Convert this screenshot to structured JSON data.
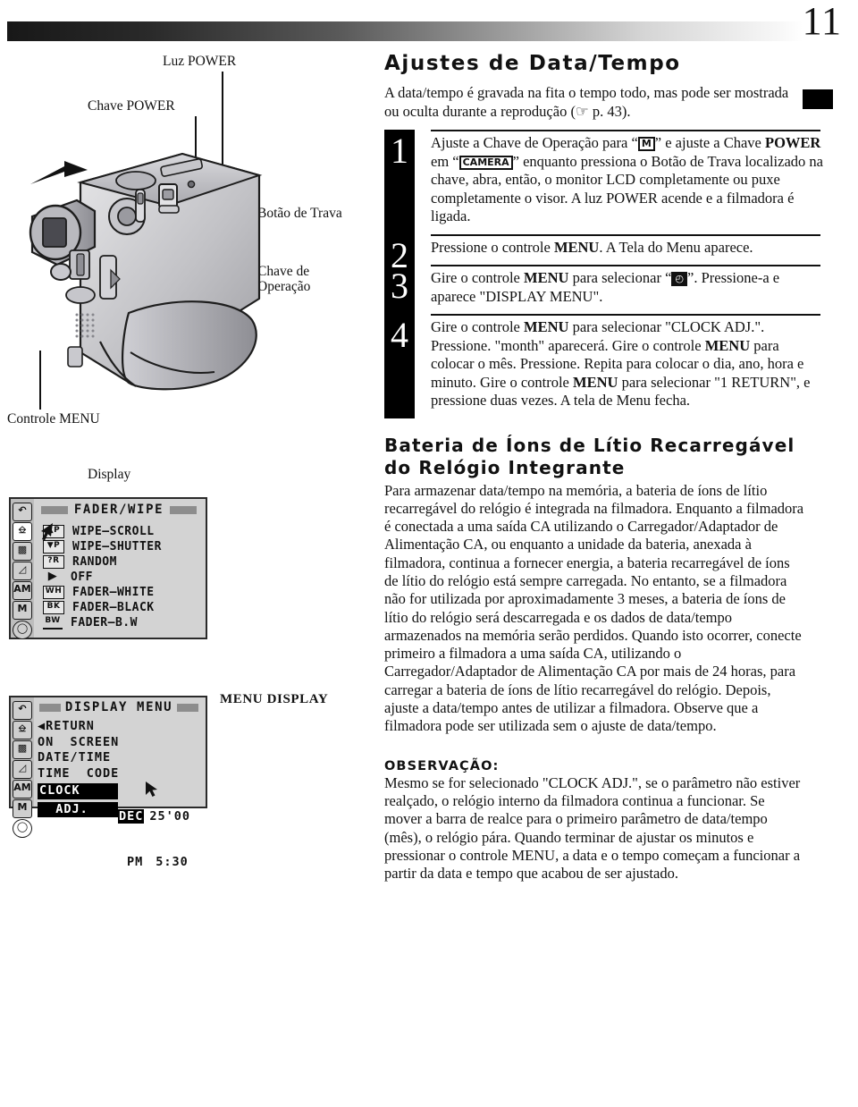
{
  "page": {
    "number": "11"
  },
  "callouts": {
    "luz_power": "Luz POWER",
    "chave_power": "Chave POWER",
    "botao_trava": "Botão de Trava",
    "chave_operacao_l1": "Chave de",
    "chave_operacao_l2": "Operação",
    "controle_menu": "Controle MENU",
    "display": "Display",
    "menu_display": "MENU DISPLAY"
  },
  "lcd_fader": {
    "title": "FADER/WIPE",
    "rail_icons": [
      "return-icon",
      "fader-wipe-icon",
      "camera-icon",
      "video-icon",
      "AM",
      "M",
      "clock-icon"
    ],
    "rows": [
      {
        "badge": "▲P",
        "label": "WIPE–SCROLL"
      },
      {
        "badge": "▼P",
        "label": "WIPE–SHUTTER"
      },
      {
        "badge": "?R",
        "label": "RANDOM"
      },
      {
        "badge": "▶",
        "label": "OFF"
      },
      {
        "badge": "WH",
        "label": "FADER–WHITE"
      },
      {
        "badge": "BK",
        "label": "FADER–BLACK"
      },
      {
        "badge": "BW",
        "label": "FADER–B.W"
      }
    ]
  },
  "lcd_display_menu": {
    "title": "DISPLAY MENU",
    "rail_icons": [
      "return-icon",
      "fader-wipe-icon",
      "camera-icon",
      "video-icon",
      "AM",
      "M",
      "clock-icon"
    ],
    "rows": [
      "◀RETURN",
      "ON  SCREEN",
      "DATE/TIME",
      "TIME  CODE"
    ],
    "highlight_l1": "CLOCK",
    "highlight_l2": "  ADJ.",
    "clock_month": "DEC",
    "clock_date": "25'00",
    "clock_ampm": "PM",
    "clock_time": "5:30"
  },
  "main": {
    "title": "Ajustes de Data/Tempo",
    "intro": "A data/tempo é gravada na fita o tempo todo, mas pode ser mostrada ou oculta durante a reprodução (☞ p. 43).",
    "steps": [
      {
        "number": "1",
        "text_a": "Ajuste a Chave de Operação para “",
        "glyph_a": "M",
        "text_b": "” e ajuste a Chave ",
        "bold_b": "POWER",
        "text_c": " em “",
        "glyph_b": "CAMERA",
        "text_d": "” enquanto pressiona o Botão de Trava localizado na chave, abra, então, o monitor LCD completamente ou puxe completamente o visor. A luz POWER acende e a filmadora é ligada."
      },
      {
        "number": "2",
        "text_a": "Pressione o controle ",
        "bold_a": "MENU",
        "text_b": ". A Tela do Menu aparece."
      },
      {
        "number": "3",
        "text_a": "Gire o controle ",
        "bold_a": "MENU",
        "text_b": " para selecionar “",
        "glyph_a": "◴",
        "text_c": "”. Pressione-a e aparece \"DISPLAY MENU\"."
      },
      {
        "number": "4",
        "text_a": "Gire o controle ",
        "bold_a": "MENU",
        "text_b": " para selecionar \"CLOCK ADJ.\". Pressione. \"month\" aparecerá. Gire o controle ",
        "bold_b": "MENU",
        "text_c": " para colocar o mês. Pressione. Repita para colocar o dia, ano, hora e minuto. Gire o controle ",
        "bold_c": "MENU",
        "text_d": " para selecionar \"1 RETURN\", e pressione duas vezes. A tela de Menu fecha."
      }
    ],
    "section2_title": "Bateria de Íons de Lítio Recarregável do Relógio Integrante",
    "section2_body": "Para armazenar data/tempo na memória, a bateria de íons de lítio recarregável do relógio é integrada na filmadora. Enquanto a filmadora é conectada a uma saída CA utilizando o Carregador/Adaptador de Alimentação CA, ou enquanto a unidade da bateria, anexada à filmadora, continua a fornecer energia, a bateria recarregável de íons de lítio do relógio está sempre carregada. No entanto, se a filmadora não for utilizada por aproximadamente 3 meses, a bateria de íons de lítio do relógio será descarregada e os dados de data/tempo armazenados na memória serão perdidos. Quando isto ocorrer, conecte primeiro a filmadora a uma saída CA, utilizando o Carregador/Adaptador de Alimentação CA por mais de 24 horas, para carregar a bateria de íons de lítio recarregável do relógio. Depois, ajuste a data/tempo antes de utilizar a filmadora. Observe que a filmadora pode ser utilizada sem o ajuste de data/tempo.",
    "note_label": "OBSERVAÇÃO:",
    "note_body": "Mesmo se for selecionado \"CLOCK ADJ.\", se o parâmetro não estiver realçado, o relógio interno da filmadora continua a funcionar. Se mover a barra de realce para o primeiro parâmetro de data/tempo (mês), o relógio pára. Quando terminar de ajustar os minutos e pressionar o controle MENU, a data e o tempo começam a funcionar a partir da data e tempo que acabou de ser ajustado."
  }
}
